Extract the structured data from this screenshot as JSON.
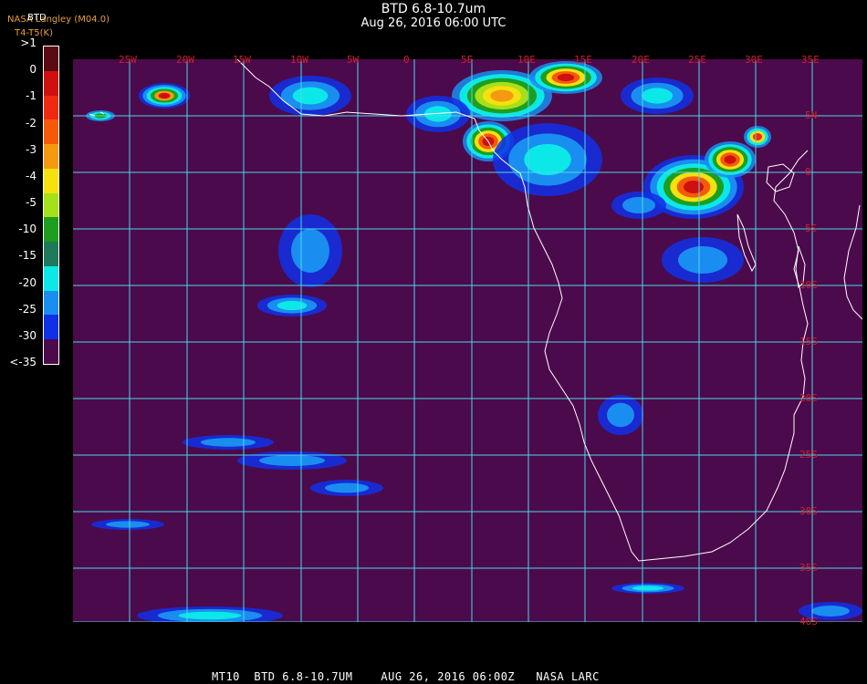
{
  "header": {
    "title": "BTD 6.8-10.7um",
    "subtitle": "Aug 26, 2016 06:00 UTC",
    "source": "NASA Langley (M04.0)",
    "product": "BTD",
    "units": "T4-T5(K)"
  },
  "legend": {
    "labels": [
      ">1",
      "0",
      "-1",
      "-2",
      "-3",
      "-4",
      "-5",
      "-10",
      "-15",
      "-20",
      "-25",
      "-30",
      "<-35"
    ],
    "colors": [
      "#5a0a12",
      "#cf1010",
      "#ef2a10",
      "#f55a0a",
      "#f59a10",
      "#f5e010",
      "#a6e01a",
      "#1e9e1e",
      "#1e7a5a",
      "#0ce8e8",
      "#1a8ef0",
      "#1030e8",
      "#4b0a4b"
    ]
  },
  "map": {
    "background": "#4b0a4b",
    "grid_color": "#4ad8e8",
    "label_color": "#d0202a",
    "coast_color": "#ffffff",
    "lon_labels": [
      "25W",
      "20W",
      "15W",
      "10W",
      "5W",
      "0",
      "5E",
      "10E",
      "15E",
      "20E",
      "25E",
      "30E",
      "35E"
    ],
    "lat_labels": [
      "5N",
      "0",
      "5S",
      "10S",
      "15S",
      "20S",
      "25S",
      "30S",
      "35S",
      "40S"
    ]
  },
  "footer": {
    "text": "MT10  BTD 6.8-10.7UM    AUG 26, 2016 06:00Z   NASA LARC"
  }
}
